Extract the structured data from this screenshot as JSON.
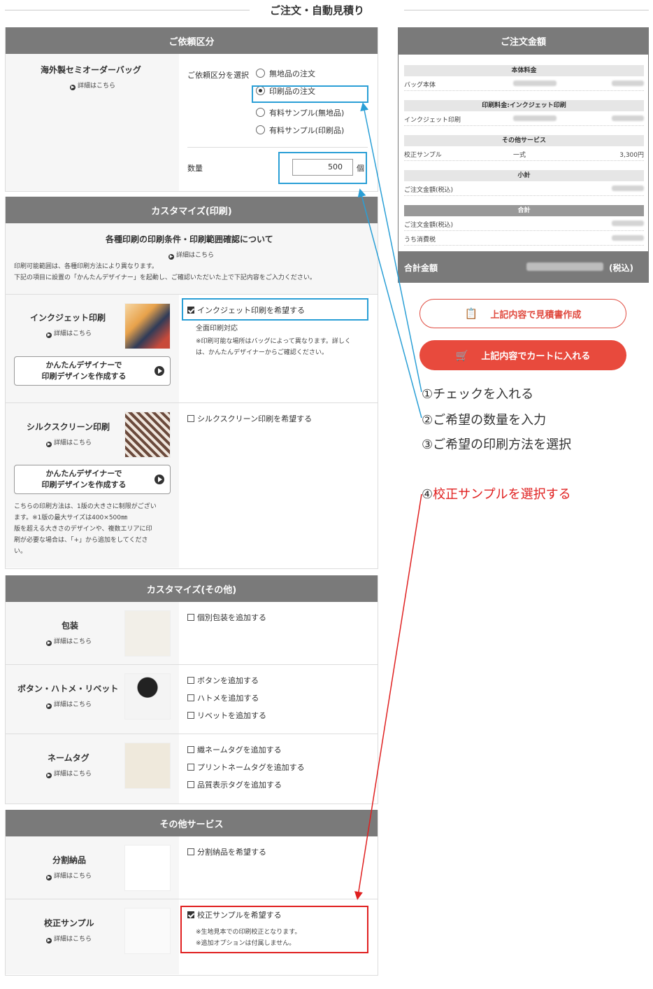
{
  "page_title": "ご注文・自動見積り",
  "detail_link": "詳細はこちら",
  "request": {
    "header": "ご依頼区分",
    "product_name": "海外製セミオーダーバッグ",
    "select_label": "ご依頼区分を選択",
    "options": [
      "無地品の注文",
      "印刷品の注文",
      "有料サンプル(無地品)",
      "有料サンプル(印刷品)"
    ],
    "selected_index": 1,
    "quantity_label": "数量",
    "quantity_value": "500",
    "quantity_unit": "個"
  },
  "print": {
    "header": "カスタマイズ(印刷)",
    "notice_title": "各種印刷の印刷条件・印刷範囲確認について",
    "notice_line1": "印刷可能範囲は、各種印刷方法により異なります。",
    "notice_line2": "下記の項目に設置の「かんたんデザイナー」を起動し、ご確認いただいた上で下記内容をご入力ください。",
    "inkjet_name": "インクジェット印刷",
    "inkjet_check": "インクジェット印刷を希望する",
    "inkjet_sub": "全面印刷対応",
    "inkjet_note1": "※印刷可能な場所はバッグによって異なります。詳しく",
    "inkjet_note2": "は、かんたんデザイナーからご確認ください。",
    "designer_line1": "かんたんデザイナーで",
    "designer_line2": "印刷デザインを作成する",
    "silk_name": "シルクスクリーン印刷",
    "silk_check": "シルクスクリーン印刷を希望する",
    "silk_note1": "こちらの印刷方法は、1版の大きさに制限がござい",
    "silk_note2": "ます。※1版の最大サイズは400×500㎜",
    "silk_note3": "版を超える大きさのデザインや、複数エリアに印",
    "silk_note4": "刷が必要な場合は、「+」から追加をしてくださ",
    "silk_note5": "い。"
  },
  "other": {
    "header": "カスタマイズ(その他)",
    "wrap_name": "包装",
    "wrap_check": "個別包装を追加する",
    "button_name": "ボタン・ハトメ・リベット",
    "button_checks": [
      "ボタンを追加する",
      "ハトメを追加する",
      "リベットを追加する"
    ],
    "tag_name": "ネームタグ",
    "tag_checks": [
      "織ネームタグを追加する",
      "プリントネームタグを追加する",
      "品質表示タグを追加する"
    ]
  },
  "service": {
    "header": "その他サービス",
    "split_name": "分割納品",
    "split_check": "分割納品を希望する",
    "sample_name": "校正サンプル",
    "sample_check": "校正サンプルを希望する",
    "sample_note1": "※生地見本での印刷校正となります。",
    "sample_note2": "※追加オプションは付属しません。"
  },
  "summary": {
    "header": "ご注文金額",
    "sec_body": "本体料金",
    "bag_label": "バッグ本体",
    "sec_print": "印刷料金:インクジェット印刷",
    "inkjet_label": "インクジェット印刷",
    "sec_other": "その他サービス",
    "sample_label": "校正サンプル",
    "sample_qty": "一式",
    "sample_price": "3,300円",
    "sec_subtotal": "小計",
    "order_label": "ご注文金額(税込)",
    "sec_total": "合計",
    "order_label2": "ご注文金額(税込)",
    "tax_label": "うち消費税",
    "total_label": "合計金額",
    "total_suffix": "(税込)"
  },
  "buttons": {
    "estimate": "上記内容で見積書作成",
    "cart": "上記内容でカートに入れる"
  },
  "steps": {
    "s1": "①チェックを入れる",
    "s2": "②ご希望の数量を入力",
    "s3": "③ご希望の印刷方法を選択",
    "s4_prefix": "④",
    "s4": "校正サンプルを選択する"
  },
  "colors": {
    "accent": "#e84a3d",
    "header": "#7a7a7a",
    "annot_blue": "#2a9fd6",
    "annot_red": "#e02020"
  }
}
